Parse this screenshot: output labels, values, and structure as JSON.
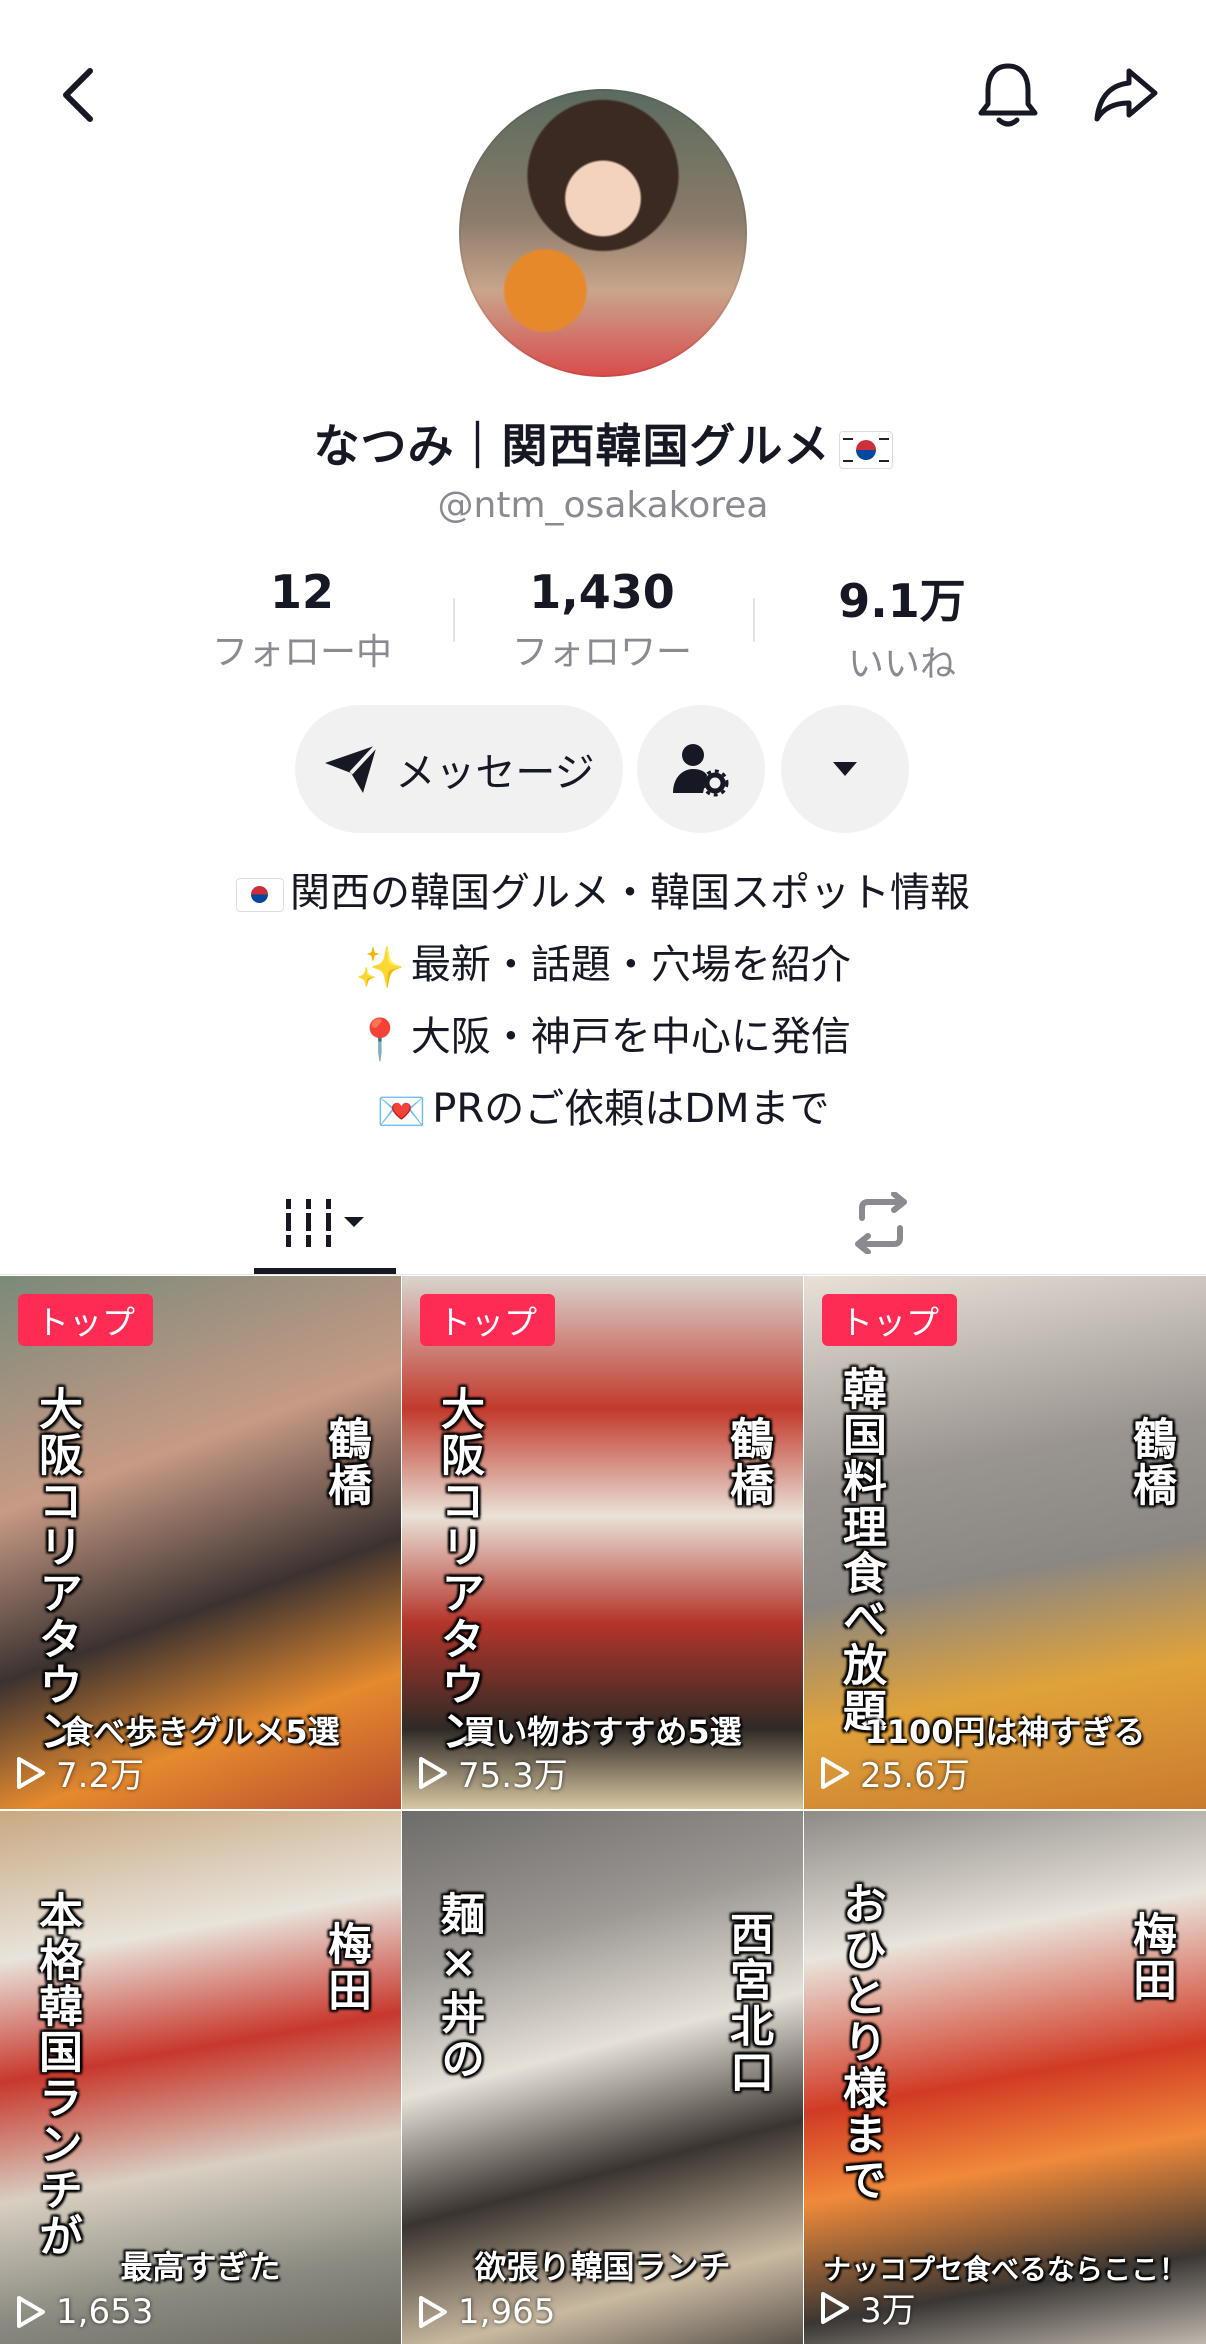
{
  "profile": {
    "display_name": "なつみ｜関西韓国グルメ",
    "handle": "@ntm_osakakorea"
  },
  "stats": [
    {
      "value": "12",
      "label": "フォロー中"
    },
    {
      "value": "1,430",
      "label": "フォロワー"
    },
    {
      "value": "9.1万",
      "label": "いいね"
    }
  ],
  "actions": {
    "message_label": "メッセージ"
  },
  "bio": [
    {
      "emoji": "flag-kr",
      "text": "関西の韓国グルメ・韓国スポット情報"
    },
    {
      "emoji": "✨",
      "text": "最新・話題・穴場を紹介"
    },
    {
      "emoji": "📍",
      "text": "大阪・神戸を中心に発信"
    },
    {
      "emoji": "💌",
      "text": "PRのご依頼はDMまで"
    }
  ],
  "videos": [
    {
      "badge": "トップ",
      "title_v": "大阪コリアタウン",
      "place": "鶴橋",
      "caption": "食べ歩きグルメ5選",
      "views": "7.2万"
    },
    {
      "badge": "トップ",
      "title_v": "大阪コリアタウン",
      "place": "鶴橋",
      "caption": "買い物おすすめ5選",
      "views": "75.3万"
    },
    {
      "badge": "トップ",
      "title_v": "韓国料理食べ放題",
      "place": "鶴橋",
      "caption": "1100円は神すぎる",
      "views": "25.6万"
    },
    {
      "badge": "",
      "title_v": "本格韓国ランチが",
      "place": "梅田",
      "caption": "最高すぎた",
      "views": "1,653"
    },
    {
      "badge": "",
      "title_v": "麺×丼の",
      "place": "西宮北口",
      "caption": "欲張り韓国ランチ",
      "views": "1,965"
    },
    {
      "badge": "",
      "title_v": "おひとり様まで",
      "place": "梅田",
      "caption": "ナッコプセ食べるならここ！",
      "views": "3万"
    }
  ]
}
